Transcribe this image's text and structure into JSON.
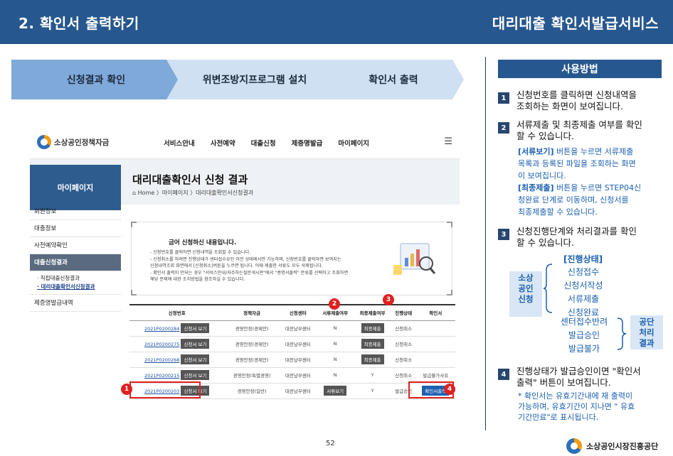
{
  "header": {
    "title": "2. 확인서 출력하기",
    "service": "대리대출 확인서발급서비스"
  },
  "steps": [
    "신청결과 확인",
    "위변조방지프로그램 설치",
    "확인서 출력"
  ],
  "screenshot": {
    "logo_text": "소상공인정책자금",
    "menu": [
      "서비스안내",
      "사전예약",
      "대출신청",
      "제증명발급",
      "마이페이지"
    ],
    "sidebar_title": "마이페이지",
    "page_title": "대리대출확인서 신청 결과",
    "breadcrumb": "Home 〉마이페이지 〉대리대출확인서신청결과",
    "sidebar_items": [
      "회원정보",
      "대출정보",
      "사전예약확인",
      "대출신청결과"
    ],
    "sidebar_subs": [
      "· 직접대출신청결과",
      "· 대리대출확인서신청결과"
    ],
    "sidebar_last": "제증명발급내역",
    "notice": {
      "title": "금어 신청하신 내용입니다.",
      "lines": [
        "- 신청번호를 클릭하면 신청내역을 조회할 수 있습니다.",
        "- 신청취소를 하려면 진행상태가 센터접수요인 이전 상태에서만 가능하며, 신청번호를 클릭하면 보여지는",
        "  신청내역조회 화면에서 [신청취소]버튼을 누르면 됩니다. 이때 제출한 서류도 모두 삭제됩니다.",
        "- 확인서 출력이 안되는 경우 \"서비스안내/자주하는질문게시판\"에서 \"증명서출력\" 분류를 선택하고 조회하면",
        "  해당 문제에 대한 조치방법을 참조하실 수 있습니다."
      ]
    },
    "table": {
      "headers": [
        "신청번호",
        "정책자금",
        "신청센터",
        "서류제출여부",
        "최종제출여부",
        "진행상태",
        "확인서"
      ],
      "view_btn": "신청서 보기",
      "rows": [
        [
          "2021P0200284",
          "경영안정(경제안)",
          "대전남부센터",
          "N",
          "최종제출",
          "신청취소",
          ""
        ],
        [
          "2021P0200275",
          "경영안정(경제안)",
          "대전남부센터",
          "N",
          "최종제출",
          "신청취소",
          ""
        ],
        [
          "2021P0200268",
          "경영안정(경제안)",
          "대전남부센터",
          "N",
          "최종제출",
          "신청취소",
          ""
        ],
        [
          "2021P0200215",
          "경영안정(특별경영)",
          "대전남부센터",
          "N",
          "Y",
          "신청취소",
          "발급불가사유"
        ],
        [
          "2021P0200203",
          "경영안정(일반)",
          "대전남부센터",
          "서류보기",
          "Y",
          "발급승인",
          "확인서출력"
        ]
      ]
    },
    "badges": [
      "1",
      "2",
      "3",
      "4"
    ]
  },
  "howto": {
    "title": "사용방법",
    "steps": [
      {
        "num": "1",
        "lines": [
          "신청번호를 클릭하면 신청내역을",
          "조회하는 화면이 보여집니다."
        ]
      },
      {
        "num": "2",
        "lines": [
          "서류제출 및 최종제출 여부를 확인",
          "할 수 있습니다."
        ]
      },
      {
        "num": "3",
        "lines": [
          "신청진행단계와 처리결과를 확인",
          "할 수 있습니다."
        ]
      },
      {
        "num": "4",
        "lines": [
          "진행상태가 발급승인이면 \"확인서",
          "출력\" 버튼이 보여집니다."
        ]
      }
    ],
    "note2a_key": "[서류보기]",
    "note2a": [
      " 버튼을 누르면 서류제출",
      "목록과 등록된 파일을 조회하는 화면",
      "이 보여집니다."
    ],
    "note2b_key": "[최종제출]",
    "note2b": [
      " 버튼을 누르면 STEP04신",
      "청완료 단계로 이동하며, 신청서를",
      "최종제출할 수 있습니다."
    ],
    "note4": [
      "* 확인서는 유효기간내에 재 출력이",
      "가능하며, 유효기간이 지나면 \" 유효",
      "기간만료\"로 표시됩니다."
    ],
    "flow": {
      "source": [
        "소상",
        "공인",
        "신청"
      ],
      "head": "[진행상태]",
      "staff": [
        "신청접수",
        "신청서작성",
        "서류제출",
        "신청완료"
      ],
      "center": [
        "센터접수반려",
        "발급승인",
        "발급불가"
      ],
      "result": [
        "공단",
        "처리",
        "결과"
      ]
    }
  },
  "footer": {
    "page": "52",
    "org": "소상공인시장진흥공단"
  }
}
